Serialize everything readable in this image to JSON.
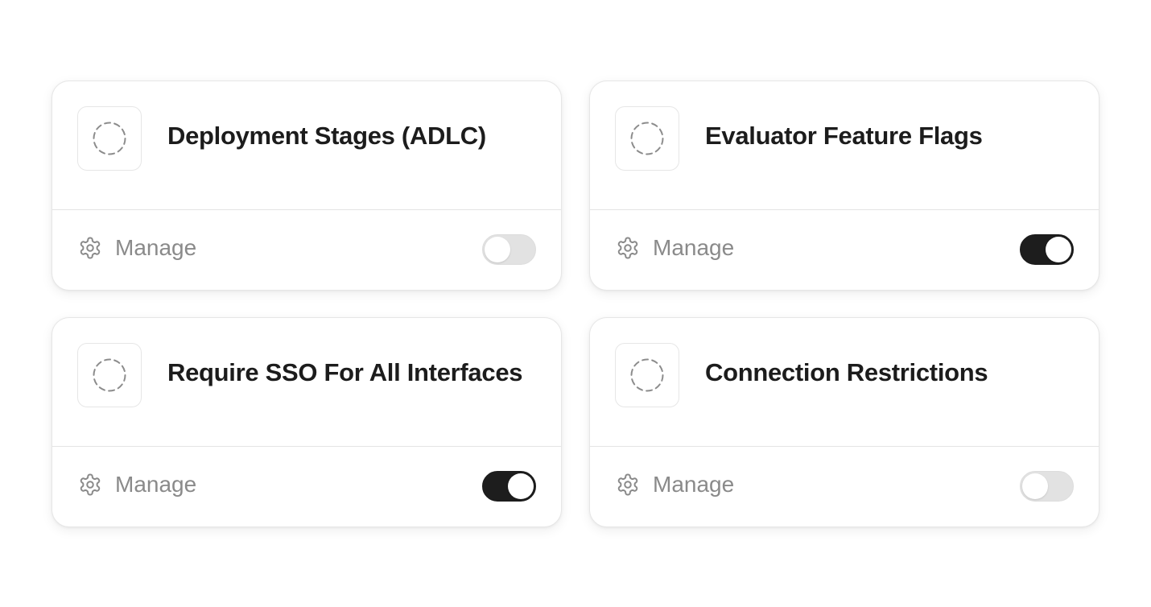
{
  "cards": [
    {
      "title": "Deployment Stages (ADLC)",
      "icon": "dashed-circle-icon",
      "manage_label": "Manage",
      "enabled": false
    },
    {
      "title": "Evaluator Feature Flags",
      "icon": "dashed-circle-icon",
      "manage_label": "Manage",
      "enabled": true
    },
    {
      "title": "Require SSO For All Interfaces",
      "icon": "dashed-circle-icon",
      "manage_label": "Manage",
      "enabled": true
    },
    {
      "title": "Connection Restrictions",
      "icon": "dashed-circle-icon",
      "manage_label": "Manage",
      "enabled": false
    }
  ],
  "colors": {
    "toggle_on": "#1d1d1d",
    "toggle_off": "#e2e2e2",
    "title_text": "#1c1c1c",
    "manage_text": "#8a8a8a"
  }
}
